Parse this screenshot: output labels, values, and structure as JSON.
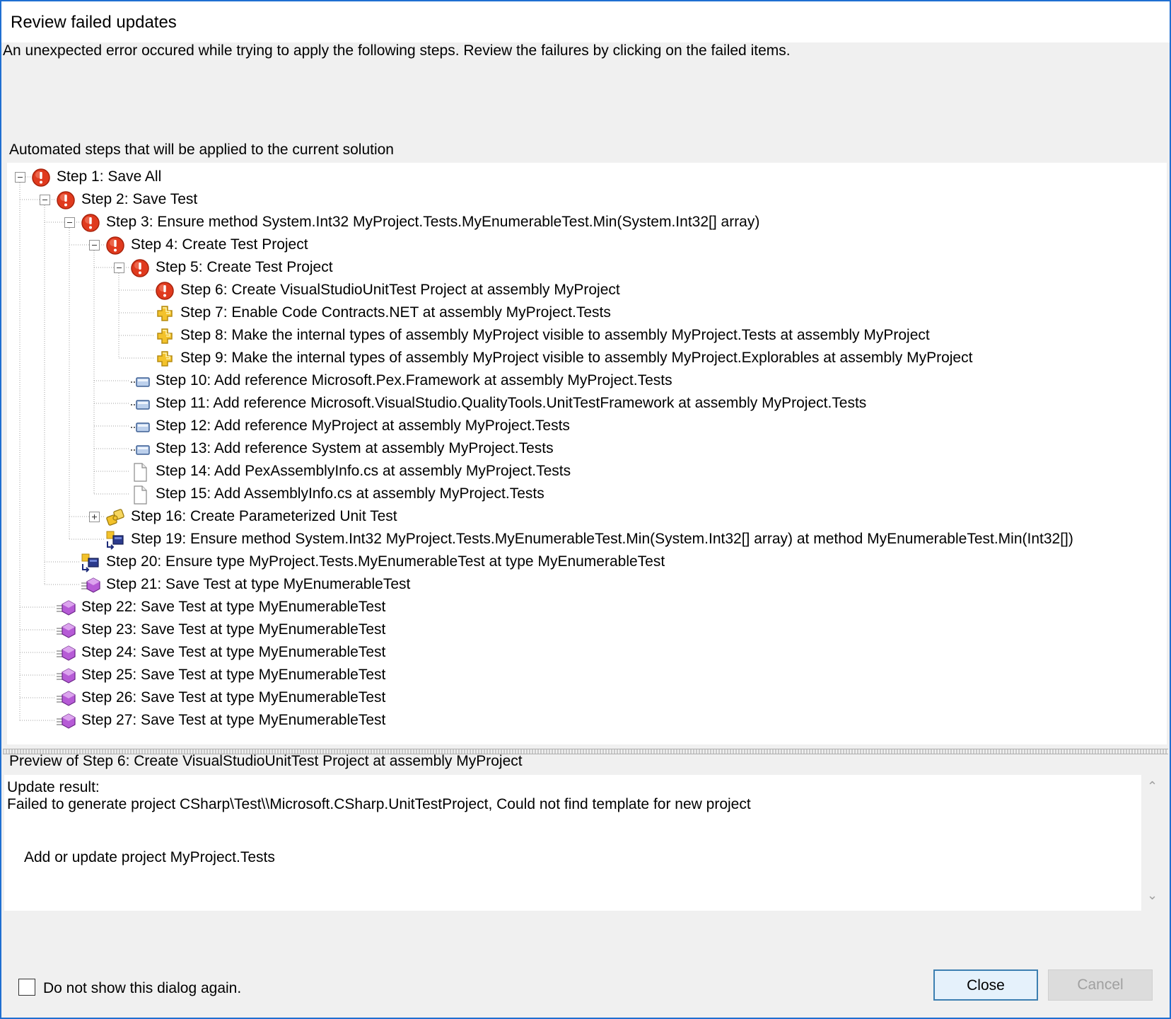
{
  "dialog": {
    "title": "Review failed updates",
    "description": "An unexpected error occured while trying to apply the following steps. Review the failures by clicking on the failed items."
  },
  "steps_caption": "Automated steps that will be applied to the current solution",
  "tree": {
    "items": [
      {
        "label": "Step 1: Save All",
        "icon": "error-icon",
        "level": 0,
        "expander": "minus"
      },
      {
        "label": "Step 2: Save Test",
        "icon": "error-icon",
        "level": 1,
        "expander": "minus"
      },
      {
        "label": "Step 3: Ensure method System.Int32 MyProject.Tests.MyEnumerableTest.Min(System.Int32[] array)",
        "icon": "error-icon",
        "level": 2,
        "expander": "minus"
      },
      {
        "label": "Step 4: Create Test Project",
        "icon": "error-icon",
        "level": 3,
        "expander": "minus"
      },
      {
        "label": "Step 5: Create Test Project",
        "icon": "error-icon",
        "level": 4,
        "expander": "minus"
      },
      {
        "label": "Step 6: Create VisualStudioUnitTest Project at assembly MyProject",
        "icon": "error-icon",
        "level": 5,
        "expander": null
      },
      {
        "label": "Step 7: Enable Code Contracts.NET at assembly MyProject.Tests",
        "icon": "plus-cross-icon",
        "level": 5,
        "expander": null
      },
      {
        "label": "Step 8: Make the internal types of assembly MyProject visible to assembly MyProject.Tests at assembly MyProject",
        "icon": "plus-cross-icon",
        "level": 5,
        "expander": null
      },
      {
        "label": "Step 9: Make the internal types of assembly MyProject visible to assembly MyProject.Explorables at assembly MyProject",
        "icon": "plus-cross-icon",
        "level": 5,
        "expander": null
      },
      {
        "label": "Step 10: Add reference Microsoft.Pex.Framework at assembly MyProject.Tests",
        "icon": "reference-icon",
        "level": 4,
        "expander": null
      },
      {
        "label": "Step 11: Add reference Microsoft.VisualStudio.QualityTools.UnitTestFramework at assembly MyProject.Tests",
        "icon": "reference-icon",
        "level": 4,
        "expander": null
      },
      {
        "label": "Step 12: Add reference MyProject at assembly MyProject.Tests",
        "icon": "reference-icon",
        "level": 4,
        "expander": null
      },
      {
        "label": "Step 13: Add reference System at assembly MyProject.Tests",
        "icon": "reference-icon",
        "level": 4,
        "expander": null
      },
      {
        "label": "Step 14: Add PexAssemblyInfo.cs at assembly MyProject.Tests",
        "icon": "file-icon",
        "level": 4,
        "expander": null
      },
      {
        "label": "Step 15: Add AssemblyInfo.cs at assembly MyProject.Tests",
        "icon": "file-icon",
        "level": 4,
        "expander": null
      },
      {
        "label": "Step 16: Create Parameterized Unit Test",
        "icon": "puzzle-icon",
        "level": 3,
        "expander": "plus"
      },
      {
        "label": "Step 19: Ensure method System.Int32 MyProject.Tests.MyEnumerableTest.Min(System.Int32[] array) at method MyEnumerableTest.Min(Int32[])",
        "icon": "ensure-icon",
        "level": 3,
        "expander": null
      },
      {
        "label": "Step 20: Ensure type MyProject.Tests.MyEnumerableTest at type MyEnumerableTest",
        "icon": "ensure-icon",
        "level": 2,
        "expander": null
      },
      {
        "label": "Step 21: Save Test at type MyEnumerableTest",
        "icon": "save-gem-icon",
        "level": 2,
        "expander": null
      },
      {
        "label": "Step 22: Save Test at type MyEnumerableTest",
        "icon": "save-gem-icon",
        "level": 1,
        "expander": null
      },
      {
        "label": "Step 23: Save Test at type MyEnumerableTest",
        "icon": "save-gem-icon",
        "level": 1,
        "expander": null
      },
      {
        "label": "Step 24: Save Test at type MyEnumerableTest",
        "icon": "save-gem-icon",
        "level": 1,
        "expander": null
      },
      {
        "label": "Step 25: Save Test at type MyEnumerableTest",
        "icon": "save-gem-icon",
        "level": 1,
        "expander": null
      },
      {
        "label": "Step 26: Save Test at type MyEnumerableTest",
        "icon": "save-gem-icon",
        "level": 1,
        "expander": null
      },
      {
        "label": "Step 27: Save Test at type MyEnumerableTest",
        "icon": "save-gem-icon",
        "level": 1,
        "expander": null
      }
    ]
  },
  "preview": {
    "caption": "Preview of Step 6: Create VisualStudioUnitTest Project at assembly MyProject",
    "result_heading": "Update result:",
    "result_message": "Failed to generate project CSharp\\Test\\\\Microsoft.CSharp.UnitTestProject, Could not find template for new project",
    "detail": "Add or update project MyProject.Tests"
  },
  "footer": {
    "dont_show_label": "Do not show this dialog again.",
    "dont_show_checked": false,
    "close_label": "Close",
    "cancel_label": "Cancel"
  },
  "colors": {
    "accent": "#1f6fd1",
    "error": "#e03a1e",
    "warning": "#f3c22b",
    "gem": "#b65bd6"
  }
}
